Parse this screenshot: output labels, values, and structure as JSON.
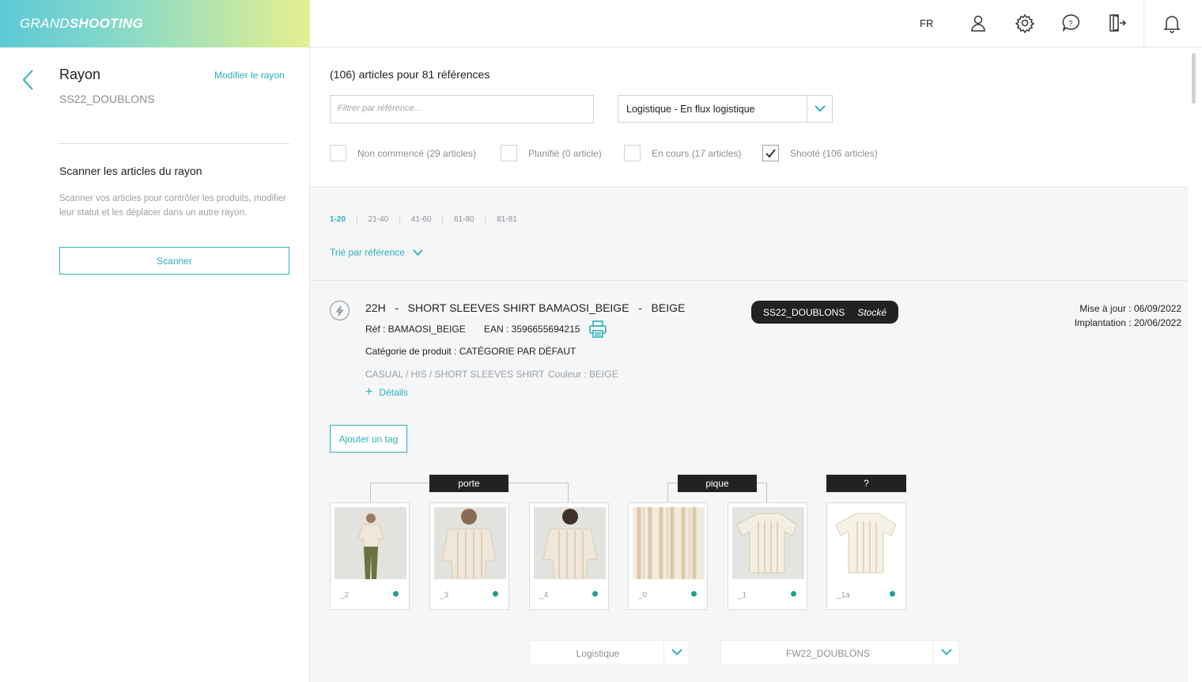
{
  "app": {
    "logo_light": "GRAND",
    "logo_bold": "SHOOTING",
    "lang": "FR"
  },
  "icons": {
    "user": "user-icon",
    "settings": "gear-icon",
    "help": "help-bubble-icon",
    "logout": "logout-icon",
    "notifications": "bell-icon"
  },
  "sidebar": {
    "title": "Rayon",
    "subtitle": "SS22_DOUBLONS",
    "modify_label": "Modifier le rayon",
    "scan_title": "Scanner les articles du rayon",
    "scan_desc": "Scanner vos articles pour contrôler les produits, modifier leur statut et les déplacer dans un autre rayon.",
    "scan_button": "Scanner"
  },
  "filters": {
    "count": "(106) articles pour 81 références",
    "search_placeholder": "Filtrer par référence...",
    "select_value": "Logistique - En flux logistique",
    "checkboxes": [
      {
        "label": "Non commencé (29 articles)",
        "checked": false
      },
      {
        "label": "Planifié (0 article)",
        "checked": false
      },
      {
        "label": "En cours (17 articles)",
        "checked": false
      },
      {
        "label": "Shooté (106 articles)",
        "checked": true
      }
    ]
  },
  "pagination": [
    "1-20",
    "21-40",
    "41-60",
    "61-80",
    "81-81"
  ],
  "sort_label": "Trié par référence",
  "product": {
    "title": "22H   -   SHORT SLEEVES SHIRT BAMAOSI_BEIGE   -   BEIGE",
    "ref": "Réf : BAMAOSI_BEIGE",
    "ean": "EAN : 3596655694215",
    "category": "Catégorie de produit : CATÉGORIE PAR DÉFAUT",
    "path": "CASUAL / HIS / SHORT SLEEVES SHIRT",
    "color": "Couleur : BEIGE",
    "details_label": "Détails",
    "badge_rayon": "SS22_DOUBLONS",
    "badge_status": "Stocké",
    "updated": "Mise à jour : 06/09/2022",
    "implanted": "Implantation : 20/06/2022",
    "add_tag_label": "Ajouter un tag",
    "groups": [
      "porte",
      "pique",
      "?"
    ],
    "thumbnails": [
      {
        "label": "_2",
        "kind": "model-front"
      },
      {
        "label": "_3",
        "kind": "model-close"
      },
      {
        "label": "_4",
        "kind": "model-back"
      },
      {
        "label": "_0",
        "kind": "fabric"
      },
      {
        "label": "_1",
        "kind": "shirt-flat"
      },
      {
        "label": "_1a",
        "kind": "shirt-flat-white"
      }
    ],
    "status_dot_color": "#1f9e8a",
    "bottom_select_1": "Logistique",
    "bottom_select_2": "FW22_DOUBLONS"
  },
  "accent_color": "#2bb0bd"
}
